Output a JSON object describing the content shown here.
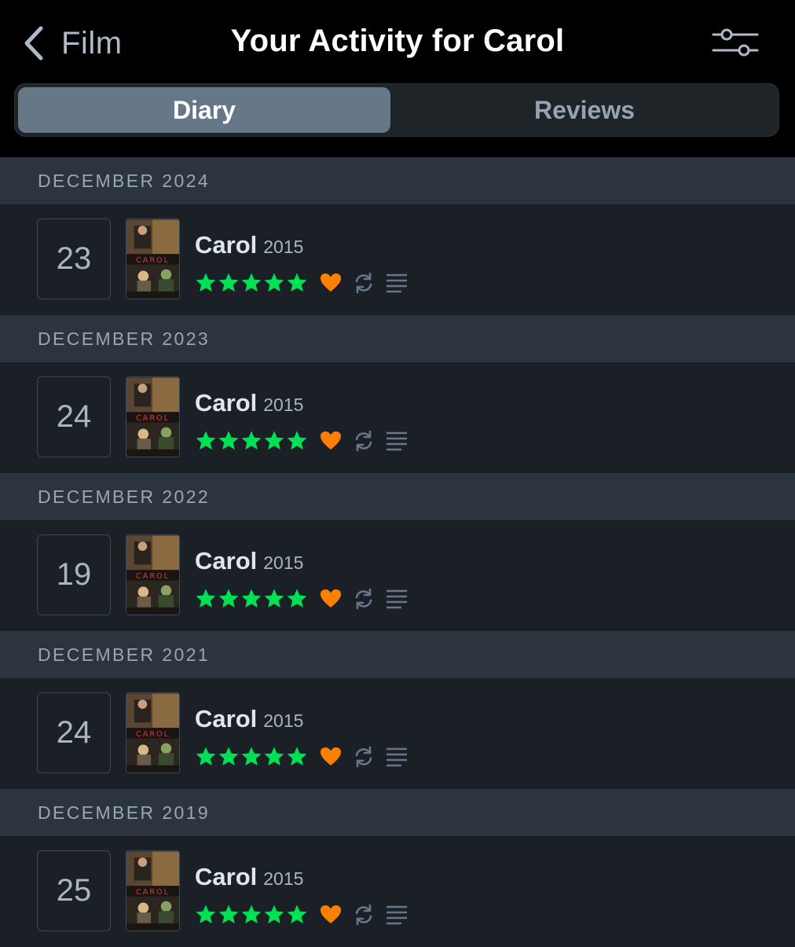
{
  "header": {
    "back_label": "Film",
    "title": "Your Activity for Carol"
  },
  "tabs": [
    {
      "label": "Diary",
      "selected": true
    },
    {
      "label": "Reviews",
      "selected": false
    }
  ],
  "poster_text": "CAROL",
  "colors": {
    "star": "#00e054",
    "heart": "#ff8000",
    "selected_tab": "#667788"
  },
  "sections": [
    {
      "month": "DECEMBER 2024",
      "entry": {
        "day": "23",
        "title": "Carol",
        "year": "2015",
        "rating_stars": 5,
        "liked": true,
        "rewatch": true,
        "has_review": true
      }
    },
    {
      "month": "DECEMBER 2023",
      "entry": {
        "day": "24",
        "title": "Carol",
        "year": "2015",
        "rating_stars": 5,
        "liked": true,
        "rewatch": true,
        "has_review": true
      }
    },
    {
      "month": "DECEMBER 2022",
      "entry": {
        "day": "19",
        "title": "Carol",
        "year": "2015",
        "rating_stars": 5,
        "liked": true,
        "rewatch": true,
        "has_review": true
      }
    },
    {
      "month": "DECEMBER 2021",
      "entry": {
        "day": "24",
        "title": "Carol",
        "year": "2015",
        "rating_stars": 5,
        "liked": true,
        "rewatch": true,
        "has_review": true
      }
    },
    {
      "month": "DECEMBER 2019",
      "entry": {
        "day": "25",
        "title": "Carol",
        "year": "2015",
        "rating_stars": 5,
        "liked": true,
        "rewatch": true,
        "has_review": true
      }
    }
  ]
}
